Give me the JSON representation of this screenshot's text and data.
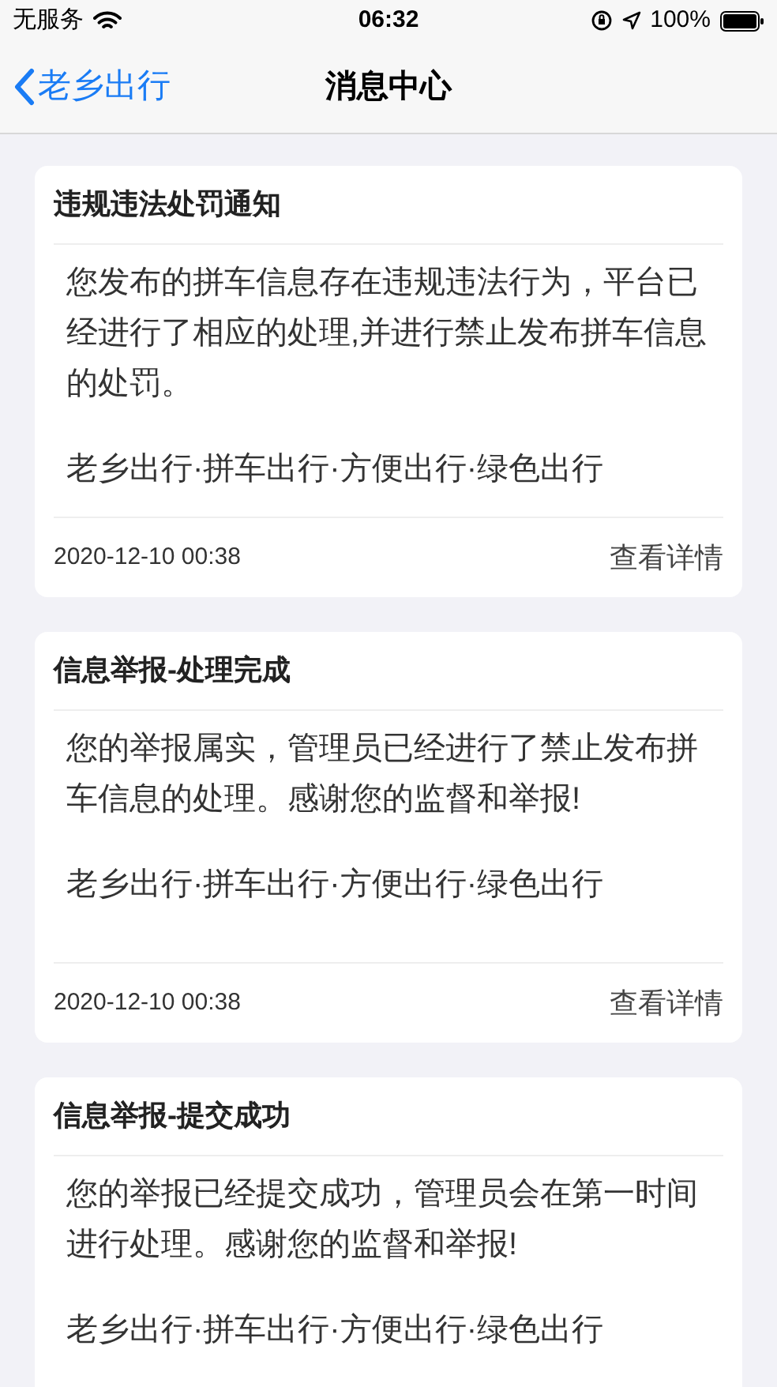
{
  "status_bar": {
    "carrier": "无服务",
    "time": "06:32",
    "battery": "100%"
  },
  "nav": {
    "back": "老乡出行",
    "title": "消息中心"
  },
  "messages": [
    {
      "title": "违规违法处罚通知",
      "body": "您发布的拼车信息存在违规违法行为，平台已经进行了相应的处理,并进行禁止发布拼车信息的处罚。",
      "slogan": "老乡出行·拼车出行·方便出行·绿色出行",
      "time": "2020-12-10 00:38",
      "action": "查看详情"
    },
    {
      "title": "信息举报-处理完成",
      "body": "您的举报属实，管理员已经进行了禁止发布拼车信息的处理。感谢您的监督和举报!",
      "slogan": "老乡出行·拼车出行·方便出行·绿色出行",
      "time": "2020-12-10 00:38",
      "action": "查看详情"
    },
    {
      "title": "信息举报-提交成功",
      "body": "您的举报已经提交成功，管理员会在第一时间进行处理。感谢您的监督和举报!",
      "slogan": "老乡出行·拼车出行·方便出行·绿色出行"
    }
  ]
}
